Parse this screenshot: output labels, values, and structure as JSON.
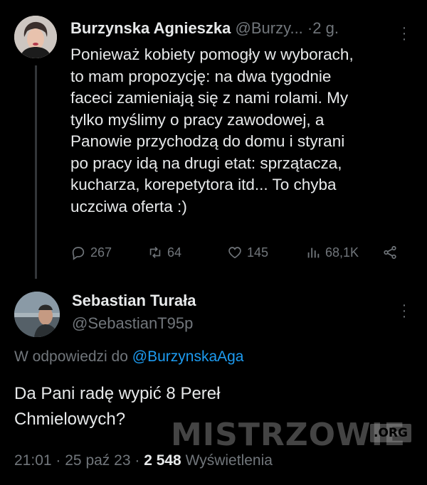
{
  "tweet": {
    "author_name": "Burzynska Agnieszka",
    "handle": "@Burzy...",
    "separator": "·",
    "time": "2 g.",
    "text": "Ponieważ kobiety pomogły w wyborach,\nto mam propozycję: na dwa tygodnie\nfaceci zamieniają się z nami rolami. My\ntylko myślimy o pracy zawodowej, a\nPanowie przychodzą do domu i styrani\npo pracy idą na drugi etat: sprzątacza,\nkucharza, korepetytora itd... To chyba\nuczciwa oferta :)",
    "replies": "267",
    "retweets": "64",
    "likes": "145",
    "views": "68,1K"
  },
  "reply": {
    "author_name": "Sebastian Turała",
    "handle": "@SebastianT95p",
    "reply_prefix": "W odpowiedzi do",
    "reply_mention": "@BurzynskaAga",
    "text": "Da Pani radę wypić 8 Pereł\nChmielowych?",
    "time": "21:01",
    "sep1": "·",
    "date": "25 paź 23",
    "sep2": "·",
    "views_count": "2 548",
    "views_label": "Wyświetlenia"
  },
  "watermark": {
    "text": "MISTRZOWIE",
    "suffix": ".ORG"
  },
  "icons": {
    "reply": "speech-bubble-icon",
    "retweet": "retweet-icon",
    "like": "heart-icon",
    "views": "bar-chart-icon",
    "share": "share-icon",
    "more": "more-dots-icon"
  },
  "colors": {
    "background": "#000000",
    "text": "#e7e9ea",
    "muted": "#71767b",
    "link": "#1d9bf0"
  }
}
